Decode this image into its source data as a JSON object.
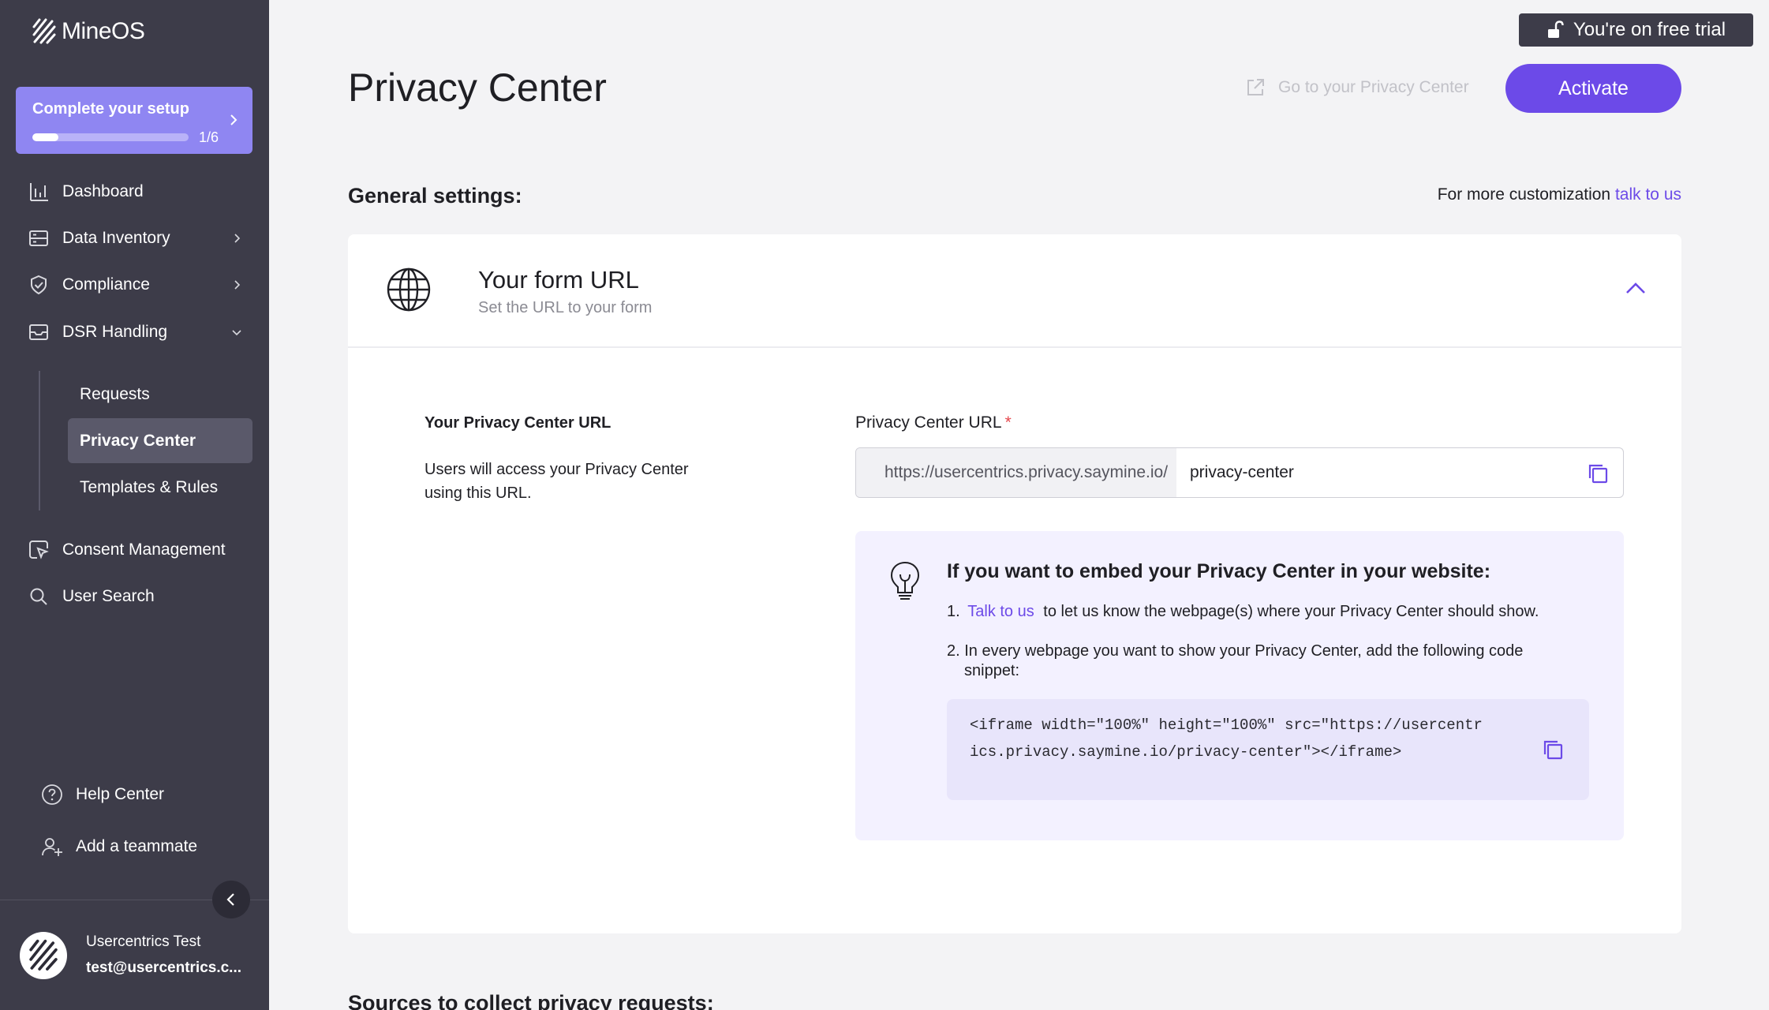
{
  "sidebar": {
    "brand": "MineOS",
    "setup": {
      "title": "Complete your setup",
      "count": "1/6",
      "progress": 0.1667
    },
    "nav": [
      {
        "label": "Dashboard"
      },
      {
        "label": "Data Inventory"
      },
      {
        "label": "Compliance"
      },
      {
        "label": "DSR Handling"
      }
    ],
    "dsr_sub": [
      {
        "label": "Requests"
      },
      {
        "label": "Privacy Center"
      },
      {
        "label": "Templates & Rules"
      }
    ],
    "nav2": [
      {
        "label": "Consent Management"
      },
      {
        "label": "User Search"
      }
    ],
    "bottom": [
      {
        "label": "Help Center"
      },
      {
        "label": "Add a teammate"
      }
    ],
    "user": {
      "name": "Usercentrics Test",
      "email": "test@usercentrics.c..."
    }
  },
  "topbar": {
    "trial": "You're on free trial",
    "title": "Privacy Center",
    "goto": "Go to your Privacy Center",
    "activate": "Activate"
  },
  "general": {
    "title": "General settings:",
    "custom_prefix": "For more customization",
    "custom_link": "talk to us"
  },
  "card": {
    "title": "Your form URL",
    "subtitle": "Set the URL to your form",
    "left_label": "Your Privacy Center URL",
    "left_desc": "Users will access your Privacy Center using this URL.",
    "url_label": "Privacy Center URL",
    "url_required": "*",
    "url_prefix": "https://usercentrics.privacy.saymine.io/",
    "url_value": "privacy-center"
  },
  "embed": {
    "title": "If you want to embed your Privacy Center in your website:",
    "step1_num": "1.",
    "step1_link": "Talk to us",
    "step1_text": "to let us know the webpage(s) where your Privacy Center should show.",
    "step2": "2. In every webpage you want to show your Privacy Center, add the following code snippet:",
    "code": "<iframe width=\"100%\" height=\"100%\" src=\"https://usercentrics.privacy.saymine.io/privacy-center\"></iframe>"
  },
  "next_section": "Sources to collect privacy requests:",
  "colors": {
    "accent": "#6c4ae8",
    "sidebar": "#3d3c49",
    "setup_card": "#8f86f2",
    "embed_bg": "#f3f1ff"
  },
  "icons": {
    "dashboard": "bar-chart-icon",
    "data_inventory": "database-icon",
    "compliance": "shield-check-icon",
    "dsr": "inbox-icon",
    "consent": "cursor-frame-icon",
    "search": "search-icon",
    "help": "question-circle-icon",
    "teammate": "user-plus-icon",
    "globe": "globe-icon",
    "bulb": "lightbulb-icon",
    "copy": "copy-icon",
    "lock": "lock-open-icon",
    "external": "external-link-icon"
  }
}
